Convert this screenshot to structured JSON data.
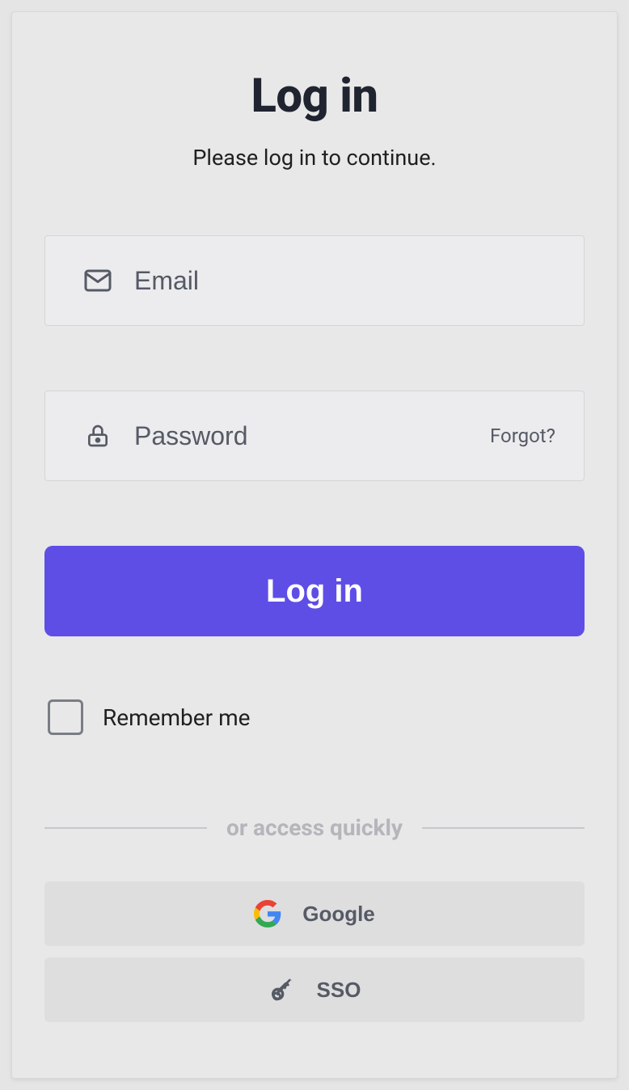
{
  "header": {
    "title": "Log in",
    "subtitle": "Please log in to continue."
  },
  "form": {
    "email_placeholder": "Email",
    "password_placeholder": "Password",
    "forgot_label": "Forgot?",
    "submit_label": "Log in",
    "remember_label": "Remember me"
  },
  "divider": {
    "label": "or access quickly"
  },
  "oauth": {
    "google_label": "Google",
    "sso_label": "SSO"
  },
  "colors": {
    "primary": "#5e4ee6",
    "text_dark": "#1f2430",
    "text_muted": "#555a65",
    "text_faint": "#b5b5bb"
  }
}
